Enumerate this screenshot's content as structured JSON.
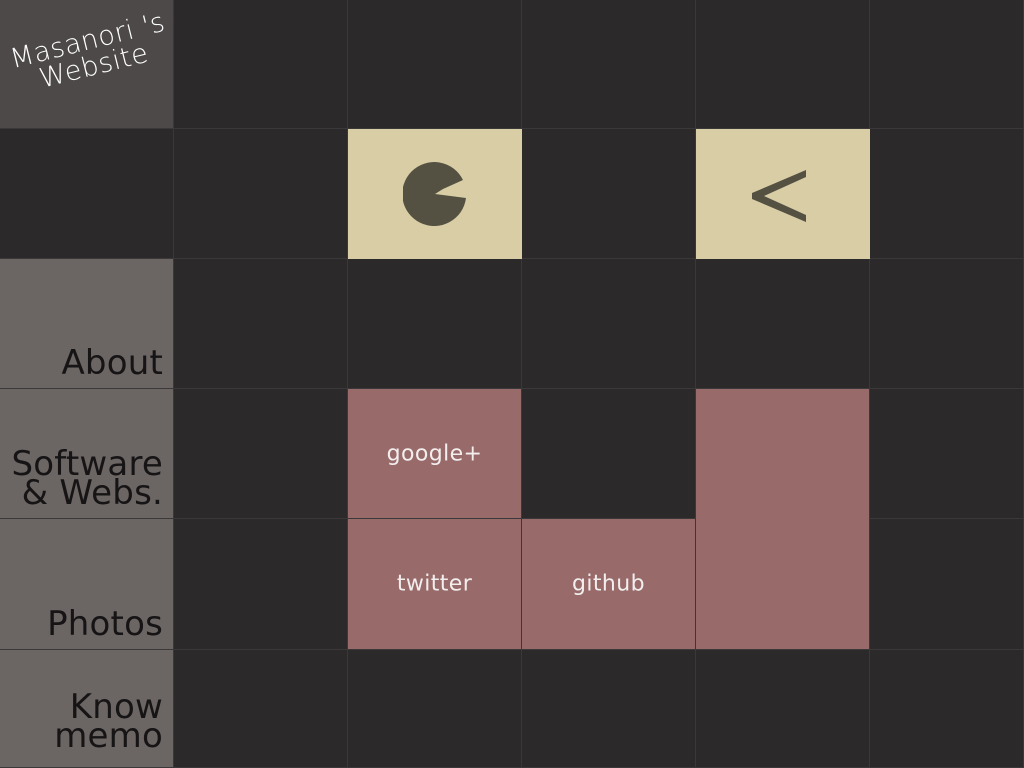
{
  "site": {
    "title_line1": "Masanori 's",
    "title_line2": "Website"
  },
  "nav": {
    "about": "About",
    "software_line1": "Software",
    "software_line2": "& Webs.",
    "photos": "Photos",
    "know_line1": "Know",
    "know_line2": "memo"
  },
  "social": {
    "google": "google+",
    "twitter": "twitter",
    "github": "github"
  },
  "icons": {
    "pacman": "pacman-icon",
    "chevron": "chevron-left-icon"
  },
  "colors": {
    "background": "#2b292a",
    "logo": "#4c4948",
    "nav": "#6b6564",
    "accent": "#d8cda5",
    "social": "#986a6a",
    "icon": "#555142"
  }
}
